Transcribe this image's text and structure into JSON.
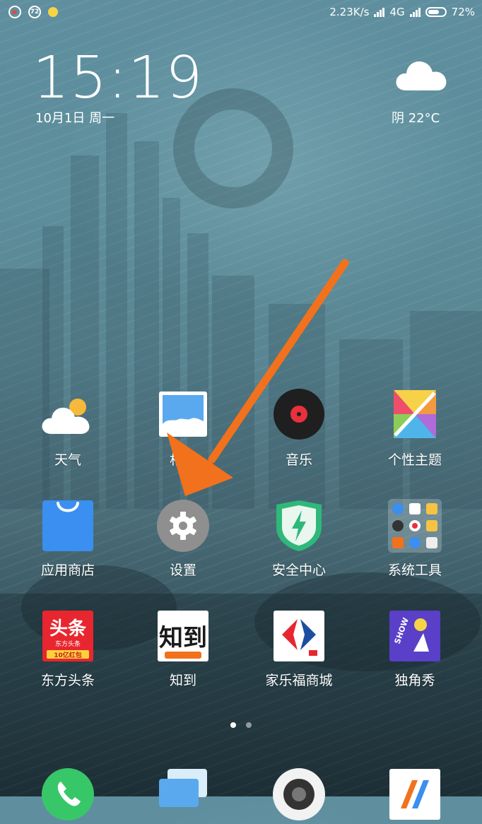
{
  "status_bar": {
    "left_icons": [
      "play-icon",
      "72",
      "yellow-dot-icon"
    ],
    "badge_text": "72",
    "net_speed": "2.23K/s",
    "network": "4G",
    "battery": "72%"
  },
  "lockwidget": {
    "time": "15:19",
    "date": "10月1日 周一",
    "weather": "阴  22°C",
    "weather_icon": "cloud-icon"
  },
  "apps": [
    {
      "label": "天气",
      "icon": "weather-icon"
    },
    {
      "label": "相册",
      "icon": "gallery-icon"
    },
    {
      "label": "音乐",
      "icon": "music-icon"
    },
    {
      "label": "个性主题",
      "icon": "themes-icon"
    },
    {
      "label": "应用商店",
      "icon": "app-store-icon"
    },
    {
      "label": "设置",
      "icon": "settings-gear-icon"
    },
    {
      "label": "安全中心",
      "icon": "security-shield-icon"
    },
    {
      "label": "系统工具",
      "icon": "system-tools-folder-icon"
    },
    {
      "label": "东方头条",
      "icon": "dongfang-toutiao-icon",
      "icon_text": "头条",
      "icon_sub": "东方头条",
      "icon_badge": "10亿红包"
    },
    {
      "label": "知到",
      "icon": "zhidao-icon",
      "icon_text": "知到"
    },
    {
      "label": "家乐福商城",
      "icon": "carrefour-icon"
    },
    {
      "label": "独角秀",
      "icon": "dujiaoxiu-icon",
      "icon_text": "SHOW"
    }
  ],
  "page_indicator": {
    "count": 2,
    "active": 0
  },
  "dock": [
    {
      "icon": "phone-icon"
    },
    {
      "icon": "messages-icon"
    },
    {
      "icon": "camera-icon"
    },
    {
      "icon": "browser-icon"
    }
  ],
  "colors": {
    "arrow": "#f2711c",
    "settings": "#8f8f8f",
    "security": "#2fb87a",
    "store": "#3a8ff0",
    "music": "#222222"
  }
}
